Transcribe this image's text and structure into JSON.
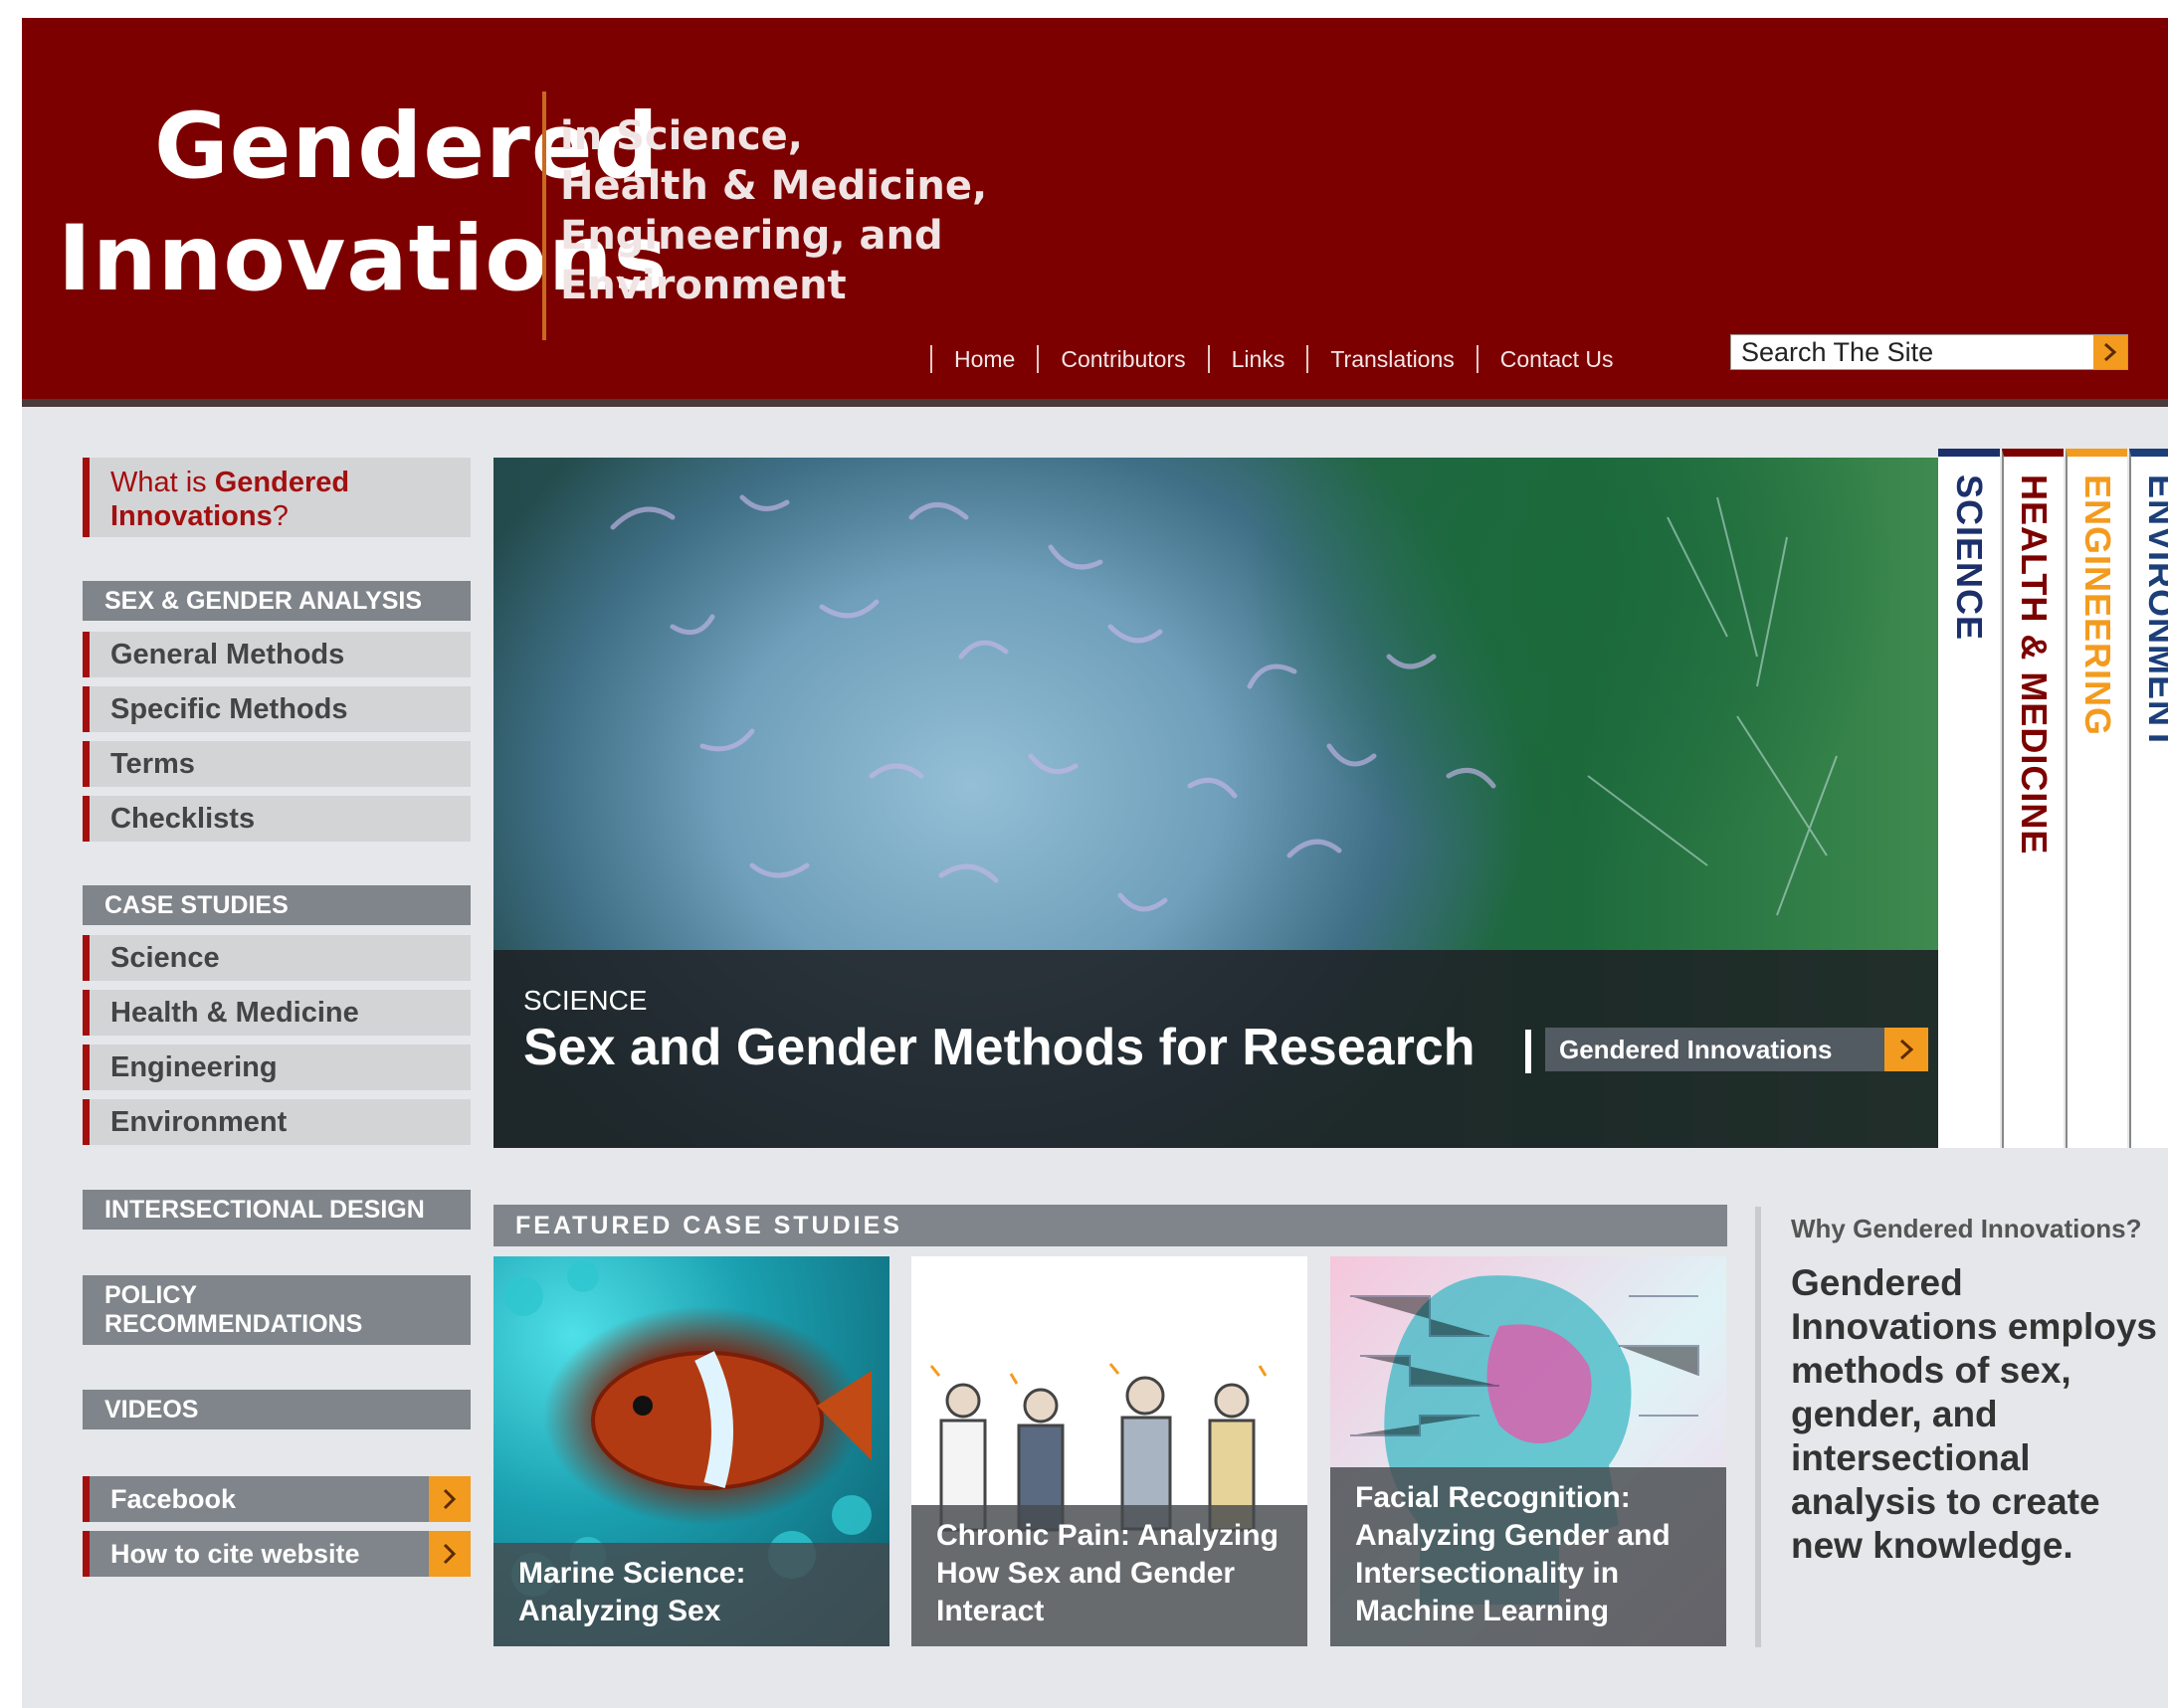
{
  "header": {
    "logo_line1": "Gendered",
    "logo_line2": "Innovations",
    "tagline": [
      "in Science,",
      "Health & Medicine,",
      "Engineering, and",
      "Environment"
    ],
    "nav": [
      "Home",
      "Contributors",
      "Links",
      "Translations",
      "Contact Us"
    ],
    "search_placeholder": "Search The Site",
    "colors": {
      "header_bg": "#7d0000",
      "accent_orange": "#f39b1f"
    }
  },
  "sidebar": {
    "what_is_prefix": "What is ",
    "what_is_bold": "Gendered Innovations",
    "what_is_suffix": "?",
    "sex_gender_heading": "SEX & GENDER ANALYSIS",
    "sex_gender_items": [
      "General Methods",
      "Specific Methods",
      "Terms",
      "Checklists"
    ],
    "case_studies_heading": "CASE STUDIES",
    "case_studies_items": [
      "Science",
      "Health & Medicine",
      "Engineering",
      "Environment"
    ],
    "intersectional_design": "INTERSECTIONAL DESIGN",
    "policy": "POLICY RECOMMENDATIONS",
    "videos": "VIDEOS",
    "links": [
      "Facebook",
      "How to cite website"
    ]
  },
  "hero": {
    "category": "SCIENCE",
    "title": "Sex and Gender Methods for Research",
    "link_label": "Gendered Innovations"
  },
  "vertical_tabs": [
    {
      "label": "SCIENCE",
      "color": "#1c2f6b"
    },
    {
      "label": "HEALTH & MEDICINE",
      "color": "#7d0000"
    },
    {
      "label": "ENGINEERING",
      "color": "#f39b1f"
    },
    {
      "label": "ENVIRONMENT",
      "color": "#1c3f7a"
    }
  ],
  "featured": {
    "heading": "FEATURED CASE STUDIES",
    "cards": [
      {
        "caption": "Marine Science: Analyzing Sex"
      },
      {
        "caption": "Chronic Pain: Analyzing How Sex and Gender Interact"
      },
      {
        "caption": "Facial Recognition: Analyzing Gender and Intersectionality in Machine Learning"
      }
    ]
  },
  "why": {
    "question": "Why Gendered Innovations?",
    "body": "Gendered Innovations employs methods of sex, gender, and intersectional analysis to create new knowledge."
  }
}
